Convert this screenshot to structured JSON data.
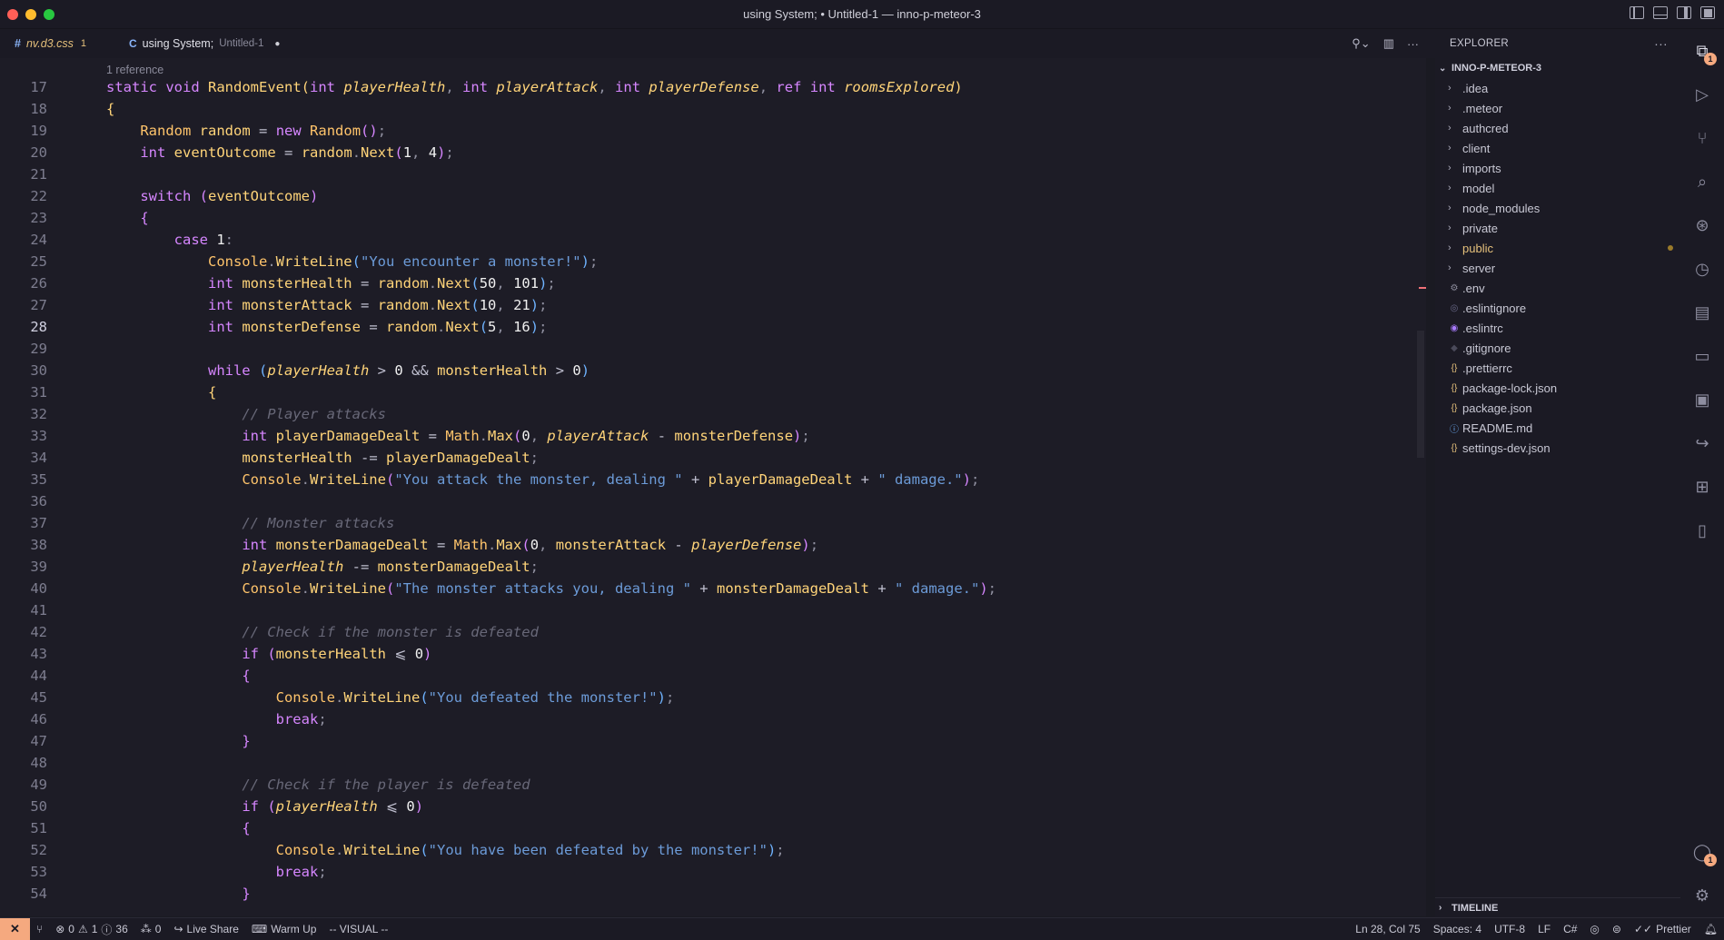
{
  "window": {
    "title": "using System; • Untitled-1 — inno-p-meteor-3"
  },
  "tabs": [
    {
      "icon": "#",
      "name": "nv.d3.css",
      "problems": "1"
    },
    {
      "icon": "C",
      "name": "using System;",
      "path": "Untitled-1",
      "dirty": "●"
    }
  ],
  "editor": {
    "reference_hint": "1 reference",
    "active_line": 28,
    "lines": [
      {
        "n": "17",
        "html": "<span class='k'>static</span> <span class='k'>void</span> <span class='f'>RandomEvent</span><span class='b1'>(</span><span class='k'>int</span> <span class='p'>playerHealth</span><span class='d'>,</span> <span class='k'>int</span> <span class='p'>playerAttack</span><span class='d'>,</span> <span class='k'>int</span> <span class='p'>playerDefense</span><span class='d'>,</span> <span class='k'>ref</span> <span class='k'>int</span> <span class='p'>roomsExplored</span><span class='b1'>)</span>"
      },
      {
        "n": "18",
        "html": "<span class='b1'>{</span>"
      },
      {
        "n": "19",
        "html": "    <span class='t'>Random</span> <span class='v'>random</span> <span class='o'>=</span> <span class='k'>new</span> <span class='t'>Random</span><span class='b2'>()</span><span class='d'>;</span>"
      },
      {
        "n": "20",
        "html": "    <span class='k'>int</span> <span class='v'>eventOutcome</span> <span class='o'>=</span> <span class='v'>random</span><span class='d'>.</span><span class='f'>Next</span><span class='b2'>(</span><span class='n'>1</span><span class='d'>,</span> <span class='n'>4</span><span class='b2'>)</span><span class='d'>;</span>"
      },
      {
        "n": "21",
        "html": ""
      },
      {
        "n": "22",
        "html": "    <span class='k'>switch</span> <span class='b2'>(</span><span class='v'>eventOutcome</span><span class='b2'>)</span>"
      },
      {
        "n": "23",
        "html": "    <span class='b2'>{</span>"
      },
      {
        "n": "24",
        "html": "        <span class='k'>case</span> <span class='n'>1</span><span class='d'>:</span>"
      },
      {
        "n": "25",
        "html": "            <span class='t'>Console</span><span class='d'>.</span><span class='f'>WriteLine</span><span class='b3'>(</span><span class='s'>\"You encounter a monster!\"</span><span class='b3'>)</span><span class='d'>;</span>"
      },
      {
        "n": "26",
        "html": "            <span class='k'>int</span> <span class='v'>monsterHealth</span> <span class='o'>=</span> <span class='v'>random</span><span class='d'>.</span><span class='f'>Next</span><span class='b3'>(</span><span class='n'>50</span><span class='d'>,</span> <span class='n'>101</span><span class='b3'>)</span><span class='d'>;</span>"
      },
      {
        "n": "27",
        "html": "            <span class='k'>int</span> <span class='v'>monsterAttack</span> <span class='o'>=</span> <span class='v'>random</span><span class='d'>.</span><span class='f'>Next</span><span class='b3'>(</span><span class='n'>10</span><span class='d'>,</span> <span class='n'>21</span><span class='b3'>)</span><span class='d'>;</span>"
      },
      {
        "n": "28",
        "html": "            <span class='k'>int</span> <span class='v'>monsterDefense</span> <span class='o'>=</span> <span class='v'>random</span><span class='d'>.</span><span class='f'>Next</span><span class='b3'>(</span><span class='n'>5</span><span class='d'>,</span> <span class='n'>16</span><span class='b3'>)</span><span class='d'>;</span>"
      },
      {
        "n": "29",
        "html": ""
      },
      {
        "n": "30",
        "html": "            <span class='k'>while</span> <span class='b3'>(</span><span class='p'>playerHealth</span> <span class='o'>&gt;</span> <span class='n'>0</span> <span class='o'>&amp;&amp;</span> <span class='v'>monsterHealth</span> <span class='o'>&gt;</span> <span class='n'>0</span><span class='b3'>)</span>"
      },
      {
        "n": "31",
        "html": "            <span class='b1'>{</span>"
      },
      {
        "n": "32",
        "html": "                <span class='c'>// Player attacks</span>"
      },
      {
        "n": "33",
        "html": "                <span class='k'>int</span> <span class='v'>playerDamageDealt</span> <span class='o'>=</span> <span class='t'>Math</span><span class='d'>.</span><span class='f'>Max</span><span class='b2'>(</span><span class='n'>0</span><span class='d'>,</span> <span class='p'>playerAttack</span> <span class='o'>-</span> <span class='v'>monsterDefense</span><span class='b2'>)</span><span class='d'>;</span>"
      },
      {
        "n": "34",
        "html": "                <span class='v'>monsterHealth</span> <span class='o'>-=</span> <span class='v'>playerDamageDealt</span><span class='d'>;</span>"
      },
      {
        "n": "35",
        "html": "                <span class='t'>Console</span><span class='d'>.</span><span class='f'>WriteLine</span><span class='b2'>(</span><span class='s'>\"You attack the monster, dealing \"</span> <span class='o'>+</span> <span class='v'>playerDamageDealt</span> <span class='o'>+</span> <span class='s'>\" damage.\"</span><span class='b2'>)</span><span class='d'>;</span>"
      },
      {
        "n": "36",
        "html": ""
      },
      {
        "n": "37",
        "html": "                <span class='c'>// Monster attacks</span>"
      },
      {
        "n": "38",
        "html": "                <span class='k'>int</span> <span class='v'>monsterDamageDealt</span> <span class='o'>=</span> <span class='t'>Math</span><span class='d'>.</span><span class='f'>Max</span><span class='b2'>(</span><span class='n'>0</span><span class='d'>,</span> <span class='v'>monsterAttack</span> <span class='o'>-</span> <span class='p'>playerDefense</span><span class='b2'>)</span><span class='d'>;</span>"
      },
      {
        "n": "39",
        "html": "                <span class='p'>playerHealth</span> <span class='o'>-=</span> <span class='v'>monsterDamageDealt</span><span class='d'>;</span>"
      },
      {
        "n": "40",
        "html": "                <span class='t'>Console</span><span class='d'>.</span><span class='f'>WriteLine</span><span class='b2'>(</span><span class='s'>\"The monster attacks you, dealing \"</span> <span class='o'>+</span> <span class='v'>monsterDamageDealt</span> <span class='o'>+</span> <span class='s'>\" damage.\"</span><span class='b2'>)</span><span class='d'>;</span>"
      },
      {
        "n": "41",
        "html": ""
      },
      {
        "n": "42",
        "html": "                <span class='c'>// Check if the monster is defeated</span>"
      },
      {
        "n": "43",
        "html": "                <span class='k'>if</span> <span class='b2'>(</span><span class='v'>monsterHealth</span> <span class='o'>⩽</span> <span class='n'>0</span><span class='b2'>)</span>"
      },
      {
        "n": "44",
        "html": "                <span class='b2'>{</span>"
      },
      {
        "n": "45",
        "html": "                    <span class='t'>Console</span><span class='d'>.</span><span class='f'>WriteLine</span><span class='b3'>(</span><span class='s'>\"You defeated the monster!\"</span><span class='b3'>)</span><span class='d'>;</span>"
      },
      {
        "n": "46",
        "html": "                    <span class='k'>break</span><span class='d'>;</span>"
      },
      {
        "n": "47",
        "html": "                <span class='b2'>}</span>"
      },
      {
        "n": "48",
        "html": ""
      },
      {
        "n": "49",
        "html": "                <span class='c'>// Check if the player is defeated</span>"
      },
      {
        "n": "50",
        "html": "                <span class='k'>if</span> <span class='b2'>(</span><span class='p'>playerHealth</span> <span class='o'>⩽</span> <span class='n'>0</span><span class='b2'>)</span>"
      },
      {
        "n": "51",
        "html": "                <span class='b2'>{</span>"
      },
      {
        "n": "52",
        "html": "                    <span class='t'>Console</span><span class='d'>.</span><span class='f'>WriteLine</span><span class='b3'>(</span><span class='s'>\"You have been defeated by the monster!\"</span><span class='b3'>)</span><span class='d'>;</span>"
      },
      {
        "n": "53",
        "html": "                    <span class='k'>break</span><span class='d'>;</span>"
      },
      {
        "n": "54",
        "html": "                <span class='b2'>}</span>"
      }
    ]
  },
  "explorer": {
    "header": "EXPLORER",
    "more_icon": "ellipsis-icon",
    "project": "INNO-P-METEOR-3",
    "items": [
      {
        "type": "folder",
        "name": ".idea"
      },
      {
        "type": "folder",
        "name": ".meteor"
      },
      {
        "type": "folder",
        "name": "authcred"
      },
      {
        "type": "folder",
        "name": "client"
      },
      {
        "type": "folder",
        "name": "imports"
      },
      {
        "type": "folder",
        "name": "model"
      },
      {
        "type": "folder",
        "name": "node_modules"
      },
      {
        "type": "folder",
        "name": "private"
      },
      {
        "type": "folder",
        "name": "public",
        "modified": true
      },
      {
        "type": "folder",
        "name": "server"
      },
      {
        "type": "file",
        "name": ".env",
        "icon": "⚙",
        "color": "#8a8a9a"
      },
      {
        "type": "file",
        "name": ".eslintignore",
        "icon": "◎",
        "color": "#6a6a8a"
      },
      {
        "type": "file",
        "name": ".eslintrc",
        "icon": "◉",
        "color": "#a97bff"
      },
      {
        "type": "file",
        "name": ".gitignore",
        "icon": "◆",
        "color": "#4a4a5a"
      },
      {
        "type": "file",
        "name": ".prettierrc",
        "icon": "{}",
        "color": "#e5c07b"
      },
      {
        "type": "file",
        "name": "package-lock.json",
        "icon": "{}",
        "color": "#e5c07b"
      },
      {
        "type": "file",
        "name": "package.json",
        "icon": "{}",
        "color": "#e5c07b"
      },
      {
        "type": "file",
        "name": "README.md",
        "icon": "ⓘ",
        "color": "#6fb3ff"
      },
      {
        "type": "file",
        "name": "settings-dev.json",
        "icon": "{}",
        "color": "#e5c07b"
      }
    ],
    "timeline": "TIMELINE"
  },
  "activity": [
    {
      "name": "files-icon",
      "glyph": "⧉",
      "active": true,
      "badge": "1"
    },
    {
      "name": "run-debug-icon",
      "glyph": "▷"
    },
    {
      "name": "source-control-icon",
      "glyph": "⑂"
    },
    {
      "name": "search-icon",
      "glyph": "⌕"
    },
    {
      "name": "git-graph-icon",
      "glyph": "⊛"
    },
    {
      "name": "git-history-icon",
      "glyph": "◷"
    },
    {
      "name": "panels-icon",
      "glyph": "▤"
    },
    {
      "name": "comments-icon",
      "glyph": "▭"
    },
    {
      "name": "remote-explorer-icon",
      "glyph": "▣"
    },
    {
      "name": "live-share-icon",
      "glyph": "↪"
    },
    {
      "name": "extensions-icon",
      "glyph": "⊞"
    },
    {
      "name": "docker-icon",
      "glyph": "▯"
    }
  ],
  "activity_bottom": [
    {
      "name": "accounts-icon",
      "glyph": "◯",
      "badge": "1"
    },
    {
      "name": "settings-gear-icon",
      "glyph": "⚙"
    }
  ],
  "status": {
    "remote": "✕",
    "errors": "0",
    "warnings": "1",
    "infos": "36",
    "ports": "0",
    "live_share": "Live Share",
    "warm_up": "Warm Up",
    "vim_mode": "-- VISUAL --",
    "position": "Ln 28, Col 75",
    "spaces": "Spaces: 4",
    "encoding": "UTF-8",
    "eol": "LF",
    "language": "C#",
    "prettier": "Prettier"
  },
  "colors": {
    "accent": "#f5a97f",
    "keyword": "#d686ff",
    "string": "#6c9bd8",
    "identifier": "#ffd479"
  }
}
